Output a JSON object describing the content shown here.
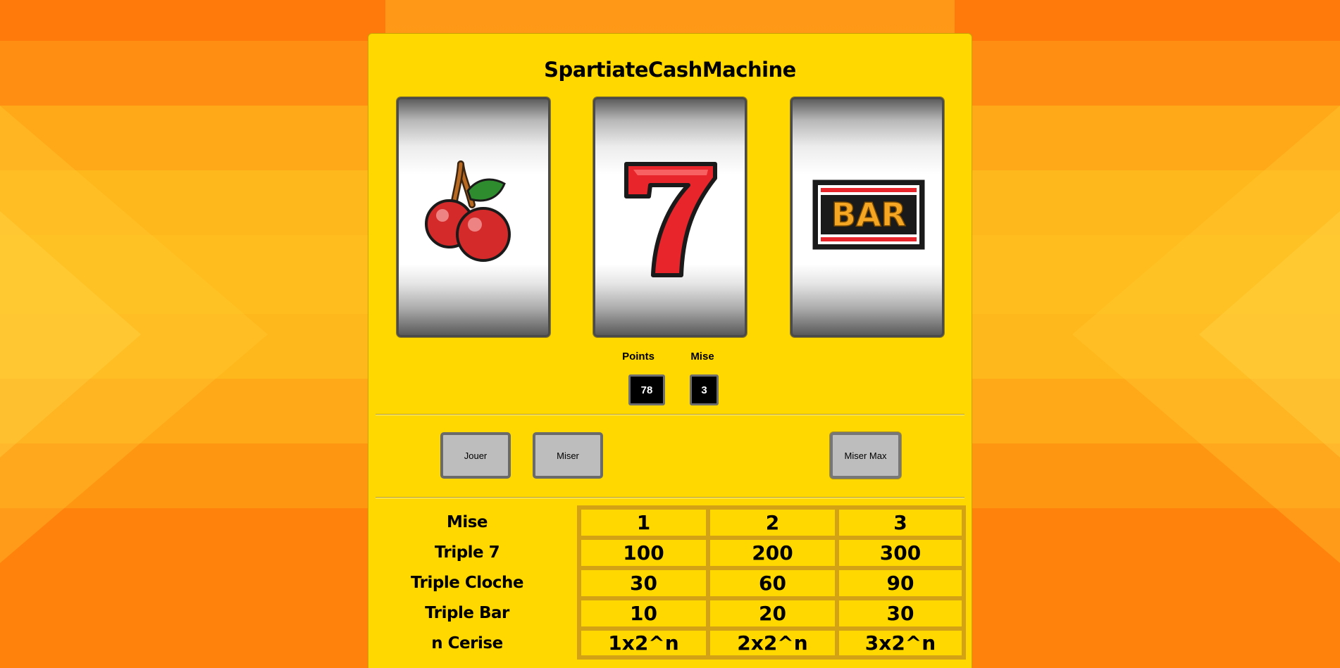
{
  "title": "SpartiateCashMachine",
  "reels": [
    {
      "symbol": "cherry-icon"
    },
    {
      "symbol": "seven-icon"
    },
    {
      "symbol": "bar-icon",
      "text": "BAR"
    }
  ],
  "stats": {
    "points_label": "Points",
    "points_value": "78",
    "mise_label": "Mise",
    "mise_value": "3"
  },
  "buttons": {
    "jouer": "Jouer",
    "miser": "Miser",
    "miser_max": "Miser Max"
  },
  "paytable": {
    "headers": [
      "Mise",
      "1",
      "2",
      "3"
    ],
    "rows": [
      {
        "label": "Triple 7",
        "values": [
          "100",
          "200",
          "300"
        ]
      },
      {
        "label": "Triple Cloche",
        "values": [
          "30",
          "60",
          "90"
        ]
      },
      {
        "label": "Triple Bar",
        "values": [
          "10",
          "20",
          "30"
        ]
      },
      {
        "label": "n Cerise",
        "values": [
          "1x2^n",
          "2x2^n",
          "3x2^n"
        ]
      }
    ]
  },
  "colors": {
    "panel": "#ffd800",
    "background": "#ff9a10",
    "grid_border": "#d4a215"
  }
}
